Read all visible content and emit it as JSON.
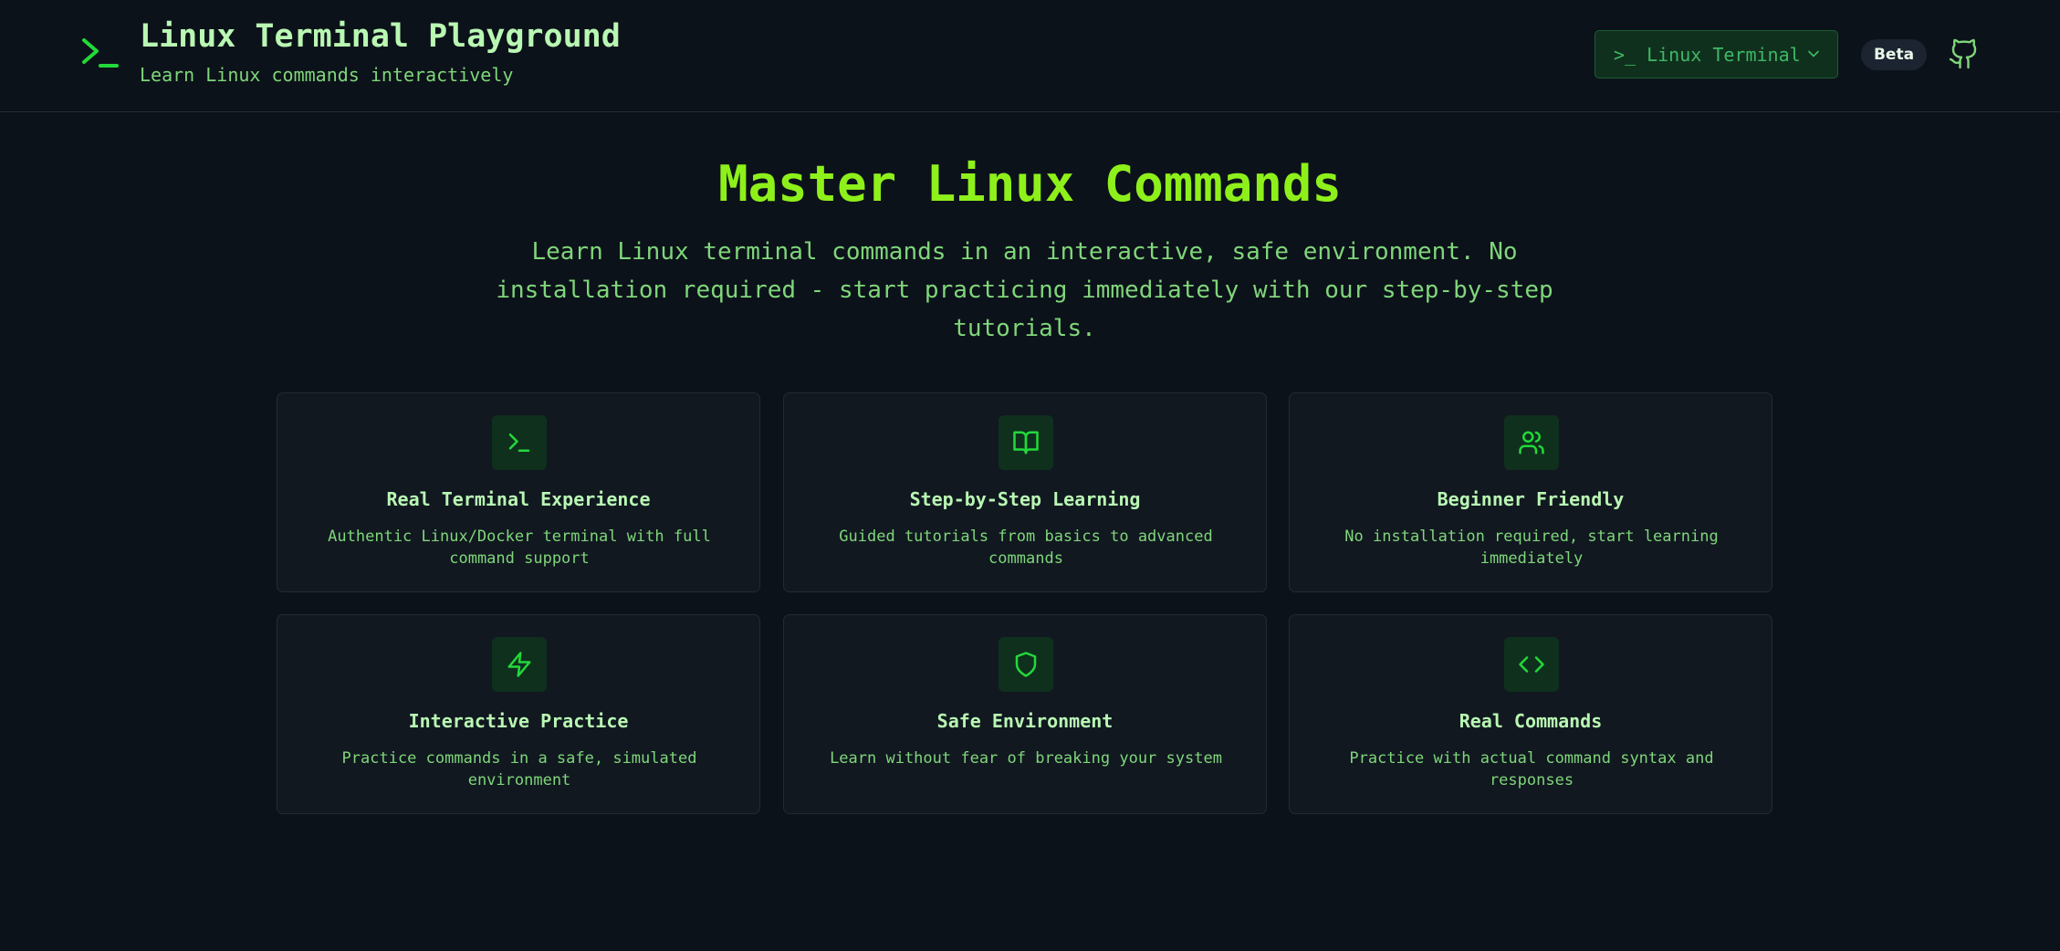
{
  "header": {
    "title": "Linux Terminal Playground",
    "subtitle": "Learn Linux commands interactively",
    "terminal_select": {
      "prompt": ">_",
      "label": "Linux Terminal"
    },
    "badge": "Beta"
  },
  "hero": {
    "title": "Master Linux Commands",
    "description": "Learn Linux terminal commands in an interactive, safe environment. No installation required - start practicing immediately with our step-by-step tutorials."
  },
  "features": [
    {
      "icon": "terminal-icon",
      "title": "Real Terminal Experience",
      "description": "Authentic Linux/Docker terminal with full command support"
    },
    {
      "icon": "book-open-icon",
      "title": "Step-by-Step Learning",
      "description": "Guided tutorials from basics to advanced commands"
    },
    {
      "icon": "users-icon",
      "title": "Beginner Friendly",
      "description": "No installation required, start learning immediately"
    },
    {
      "icon": "zap-icon",
      "title": "Interactive Practice",
      "description": "Practice commands in a safe, simulated environment"
    },
    {
      "icon": "shield-icon",
      "title": "Safe Environment",
      "description": "Learn without fear of breaking your system"
    },
    {
      "icon": "code-icon",
      "title": "Real Commands",
      "description": "Practice with actual command syntax and responses"
    }
  ],
  "colors": {
    "background": "#0c121a",
    "accent": "#8ef01a",
    "icon_green": "#22d93a",
    "text_light": "#b9f7b3",
    "text_muted": "#7fd67a"
  }
}
